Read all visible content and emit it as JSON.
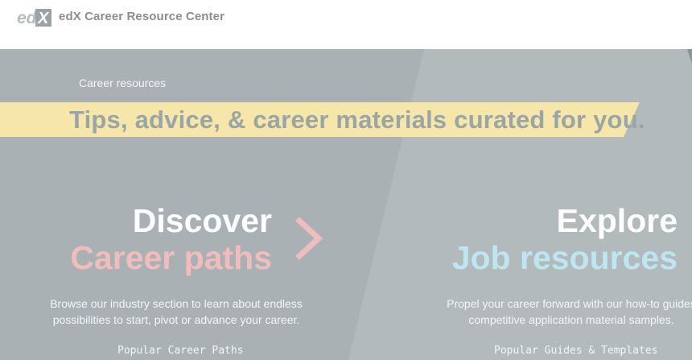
{
  "header": {
    "logo_text": "edX",
    "brand": "edX Career Resource Center"
  },
  "hero": {
    "kicker": "Career resources",
    "banner": "Tips, advice, & career materials curated for you.",
    "discover": {
      "title": "Discover",
      "subtitle": "Career paths",
      "description_line1": "Browse our industry section to learn about endless",
      "description_line2": "possibilities to start, pivot or advance your career.",
      "popular": "Popular Career Paths",
      "icon": "chevron-right-icon"
    },
    "explore": {
      "title": "Explore",
      "subtitle": "Job resources",
      "description_line1": "Propel your career forward with our how-to guides",
      "description_line2": "competitive application material samples.",
      "popular": "Popular Guides & Templates"
    }
  },
  "colors": {
    "hero_bg": "#aab1b4",
    "banner_bg": "#f6e6a9",
    "discover_accent": "#f0bcbc",
    "explore_accent": "#bde6f1",
    "brand_text": "#8a8e92"
  }
}
